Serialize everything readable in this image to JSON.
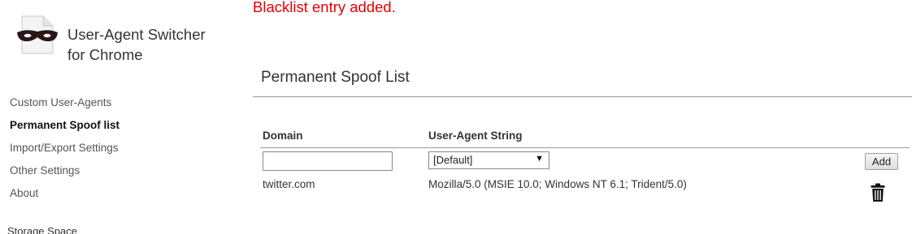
{
  "app": {
    "title_line1": "User-Agent Switcher",
    "title_line2": "for Chrome"
  },
  "sidebar": {
    "items": [
      {
        "label": "Custom User-Agents",
        "active": false
      },
      {
        "label": "Permanent Spoof list",
        "active": true
      },
      {
        "label": "Import/Export Settings",
        "active": false
      },
      {
        "label": "Other Settings",
        "active": false
      },
      {
        "label": "About",
        "active": false
      }
    ],
    "storage_label": "Storage Space"
  },
  "main": {
    "status_message": "Blacklist entry added.",
    "section_title": "Permanent Spoof List",
    "table": {
      "headers": {
        "domain": "Domain",
        "user_agent": "User-Agent String"
      },
      "new_entry": {
        "domain_value": "",
        "user_agent_selected": "[Default]",
        "add_label": "Add"
      },
      "rows": [
        {
          "domain": "twitter.com",
          "user_agent": "Mozilla/5.0 (MSIE 10.0; Windows NT 6.1; Trident/5.0)",
          "delete_icon": "trash-icon"
        }
      ]
    }
  },
  "colors": {
    "status": "#e60000",
    "text": "#333333",
    "divider": "#999999"
  }
}
